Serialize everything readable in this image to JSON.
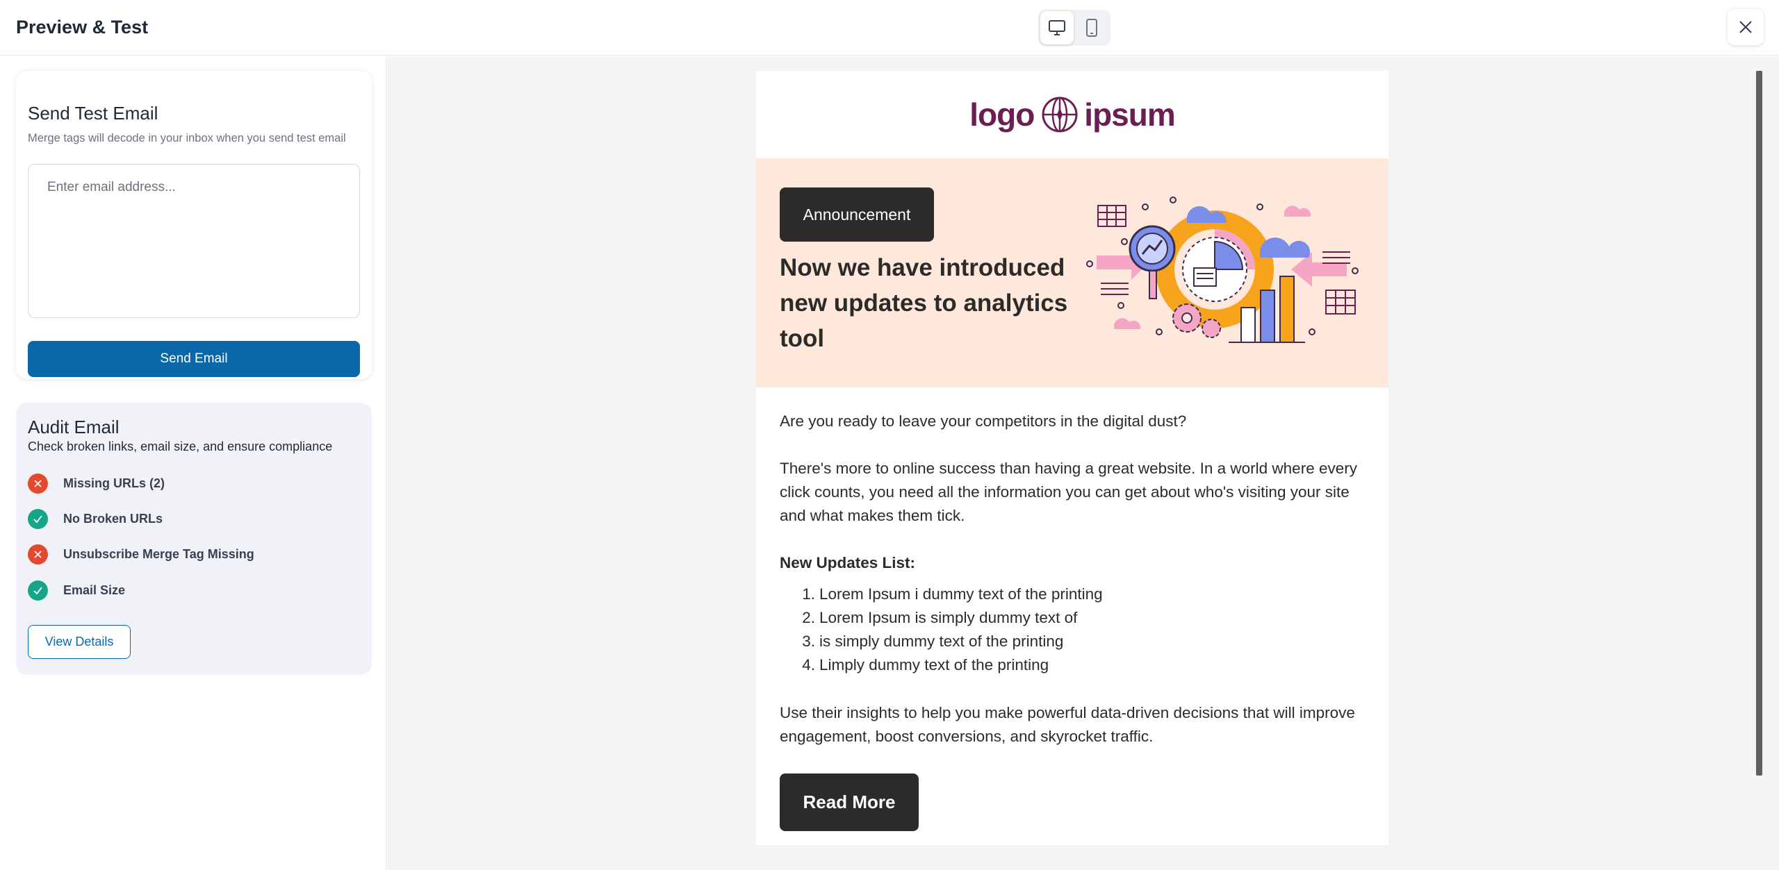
{
  "header": {
    "title": "Preview & Test",
    "devices": [
      "desktop-icon",
      "mobile-icon"
    ],
    "active_device": "desktop"
  },
  "send_test": {
    "title": "Send Test Email",
    "subtitle": "Merge tags will decode in your inbox when you send test email",
    "input_placeholder": "Enter email address...",
    "input_value": "",
    "button_label": "Send Email"
  },
  "audit": {
    "title": "Audit Email",
    "subtitle": "Check broken links, email size, and ensure compliance",
    "items": [
      {
        "label": "Missing URLs (2)",
        "status": "fail"
      },
      {
        "label": "No Broken URLs",
        "status": "pass"
      },
      {
        "label": "Unsubscribe Merge Tag Missing",
        "status": "fail"
      },
      {
        "label": "Email Size",
        "status": "pass"
      }
    ],
    "button_label": "View Details"
  },
  "email": {
    "logo": {
      "left": "logo",
      "right": "ipsum"
    },
    "badge": "Announcement",
    "hero_title": "Now we have introduced new updates to analytics tool",
    "p1": "Are you ready to leave your competitors in the digital dust?",
    "p2": "There's more to online success than having a great website. In a world where every click counts, you need all the information you can get about who's visiting your site and what makes them tick.",
    "list_title": "New Updates List:",
    "list": [
      "Lorem Ipsum i dummy text of the printing",
      "Lorem Ipsum is simply dummy text of",
      "is simply dummy text of the printing",
      "Limply dummy text of the printing"
    ],
    "p3": "Use their insights to help you make powerful data-driven decisions that will improve engagement, boost conversions, and skyrocket traffic.",
    "cta": "Read More"
  },
  "colors": {
    "primary": "#0a68a8",
    "fail": "#e3492e",
    "pass": "#17a589",
    "hero_bg": "#fde8db",
    "dark": "#2d2a2a",
    "logo": "#6b1e51"
  }
}
